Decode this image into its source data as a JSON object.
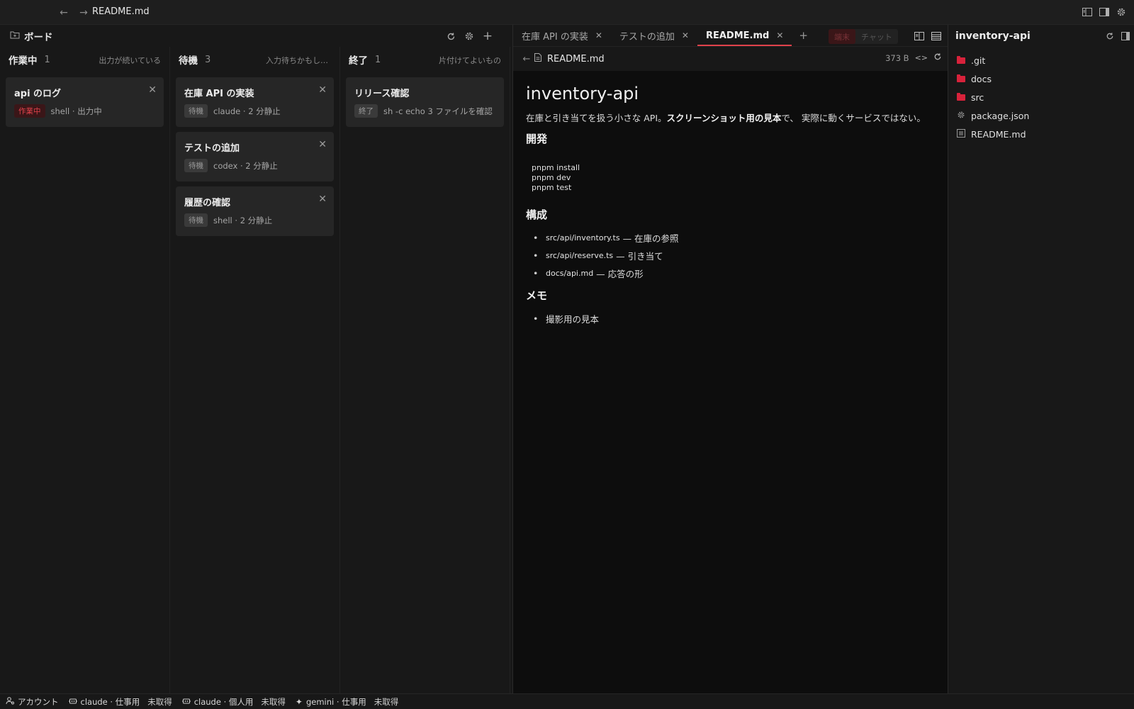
{
  "titlebar": {
    "title": "README.md",
    "back_icon": "←",
    "forward_icon": "→"
  },
  "board": {
    "title": "ボード",
    "columns": [
      {
        "name": "作業中",
        "count": "1",
        "hint": "出力が続いている",
        "cards": [
          {
            "title": "api のログ",
            "status": "作業中",
            "meta": "shell · 出力中",
            "status_color": "red"
          }
        ]
      },
      {
        "name": "待機",
        "count": "3",
        "hint": "入力待ちかもしれない",
        "cards": [
          {
            "title": "在庫 API の実装",
            "status": "待機",
            "meta": "claude · 2 分静止"
          },
          {
            "title": "テストの追加",
            "status": "待機",
            "meta": "codex · 2 分静止"
          },
          {
            "title": "履歴の確認",
            "status": "待機",
            "meta": "shell · 2 分静止"
          }
        ]
      },
      {
        "name": "終了",
        "count": "1",
        "hint": "片付けてよいもの",
        "cards": [
          {
            "title": "リリース確認",
            "status": "終了",
            "meta": "sh -c echo 3 ファイルを確認"
          }
        ]
      }
    ]
  },
  "editor": {
    "tabs": [
      {
        "label": "在庫 API の実装"
      },
      {
        "label": "テストの追加"
      },
      {
        "label": "README.md",
        "active": true
      }
    ],
    "mode": {
      "terminal": "端末",
      "chat": "チャット"
    },
    "path": {
      "file": "README.md",
      "size": "373 B"
    },
    "doc": {
      "h1": "inventory-api",
      "intro_a": "在庫と引き当てを扱う小さな API。",
      "intro_b": "スクリーンショット用の見本",
      "intro_c": "で、 実際に動くサービスではない。",
      "h2_dev": "開発",
      "code": "pnpm install\npnpm dev\npnpm test",
      "h2_struct": "構成",
      "struct": [
        {
          "code": "src/api/inventory.ts",
          "text": "— 在庫の参照"
        },
        {
          "code": "src/api/reserve.ts",
          "text": "— 引き当て"
        },
        {
          "code": "docs/api.md",
          "text": "— 応答の形"
        }
      ],
      "h2_memo": "メモ",
      "memo": [
        "撮影用の見本"
      ]
    }
  },
  "explorer": {
    "title": "inventory-api",
    "items": [
      {
        "name": ".git",
        "type": "folder"
      },
      {
        "name": "docs",
        "type": "folder"
      },
      {
        "name": "src",
        "type": "folder"
      },
      {
        "name": "package.json",
        "type": "config"
      },
      {
        "name": "README.md",
        "type": "doc"
      }
    ]
  },
  "statusbar": {
    "account": "アカウント",
    "items": [
      {
        "label": "claude · 仕事用",
        "status": "未取得"
      },
      {
        "label": "claude · 個人用",
        "status": "未取得"
      },
      {
        "label": "gemini · 仕事用",
        "status": "未取得"
      }
    ]
  },
  "colors": {
    "accent": "#e0424b",
    "folder": "#d8223b",
    "bg": "#181818",
    "editor_bg": "#0d0d0d"
  }
}
